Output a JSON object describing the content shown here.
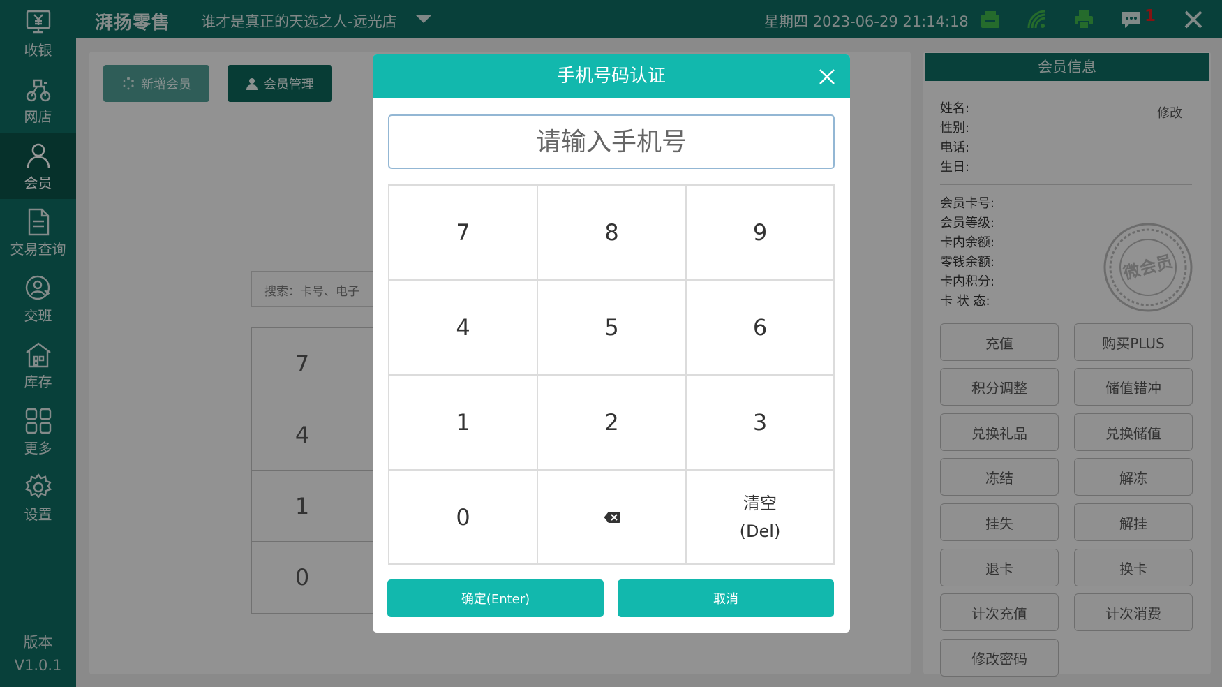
{
  "topbar": {
    "brand": "湃扬零售",
    "store": "谁才是真正的天选之人-远光店",
    "datetime": "星期四 2023-06-29 21:14:18",
    "message_count": "1",
    "icons": [
      "cash-drawer-icon",
      "wifi-icon",
      "printer-icon",
      "message-icon",
      "close-icon"
    ],
    "colors": {
      "bar": "#0e6b61",
      "badge": "#e02020"
    }
  },
  "sidebar": {
    "items": [
      {
        "label": "收银",
        "icon": "cashier-icon"
      },
      {
        "label": "网店",
        "icon": "online-store-icon"
      },
      {
        "label": "会员",
        "icon": "member-icon",
        "active": true
      },
      {
        "label": "交易查询",
        "icon": "transaction-icon"
      },
      {
        "label": "交班",
        "icon": "shift-icon"
      },
      {
        "label": "库存",
        "icon": "inventory-icon"
      },
      {
        "label": "更多",
        "icon": "more-icon"
      },
      {
        "label": "设置",
        "icon": "settings-icon"
      }
    ],
    "version_label": "版本",
    "version_value": "V1.0.1"
  },
  "main": {
    "add_member": "新增会员",
    "manage_member": "会员管理",
    "search_placeholder": "搜索：卡号、电子",
    "bg_keys": [
      "7",
      "4",
      "1",
      "0"
    ]
  },
  "member_panel": {
    "title": "会员信息",
    "edit": "修改",
    "fields": [
      "姓名:",
      "性别:",
      "电话:",
      "生日:"
    ],
    "card_fields": [
      "会员卡号:",
      "会员等级:",
      "卡内余额:",
      "零钱余额:",
      "卡内积分:",
      "卡 状 态:"
    ],
    "stamp_text": "微会员",
    "actions": [
      "充值",
      "购买PLUS",
      "积分调整",
      "储值错冲",
      "兑换礼品",
      "兑换储值",
      "冻结",
      "解冻",
      "挂失",
      "解挂",
      "退卡",
      "换卡",
      "计次充值",
      "计次消费",
      "修改密码"
    ]
  },
  "dialog": {
    "title": "手机号码认证",
    "input_placeholder": "请输入手机号",
    "keys": [
      "7",
      "8",
      "9",
      "4",
      "5",
      "6",
      "1",
      "2",
      "3",
      "0"
    ],
    "clear_line1": "清空",
    "clear_line2": "(Del)",
    "confirm": "确定(Enter)",
    "cancel": "取消",
    "colors": {
      "header": "#12b8ad",
      "button": "#12b8ad"
    }
  }
}
